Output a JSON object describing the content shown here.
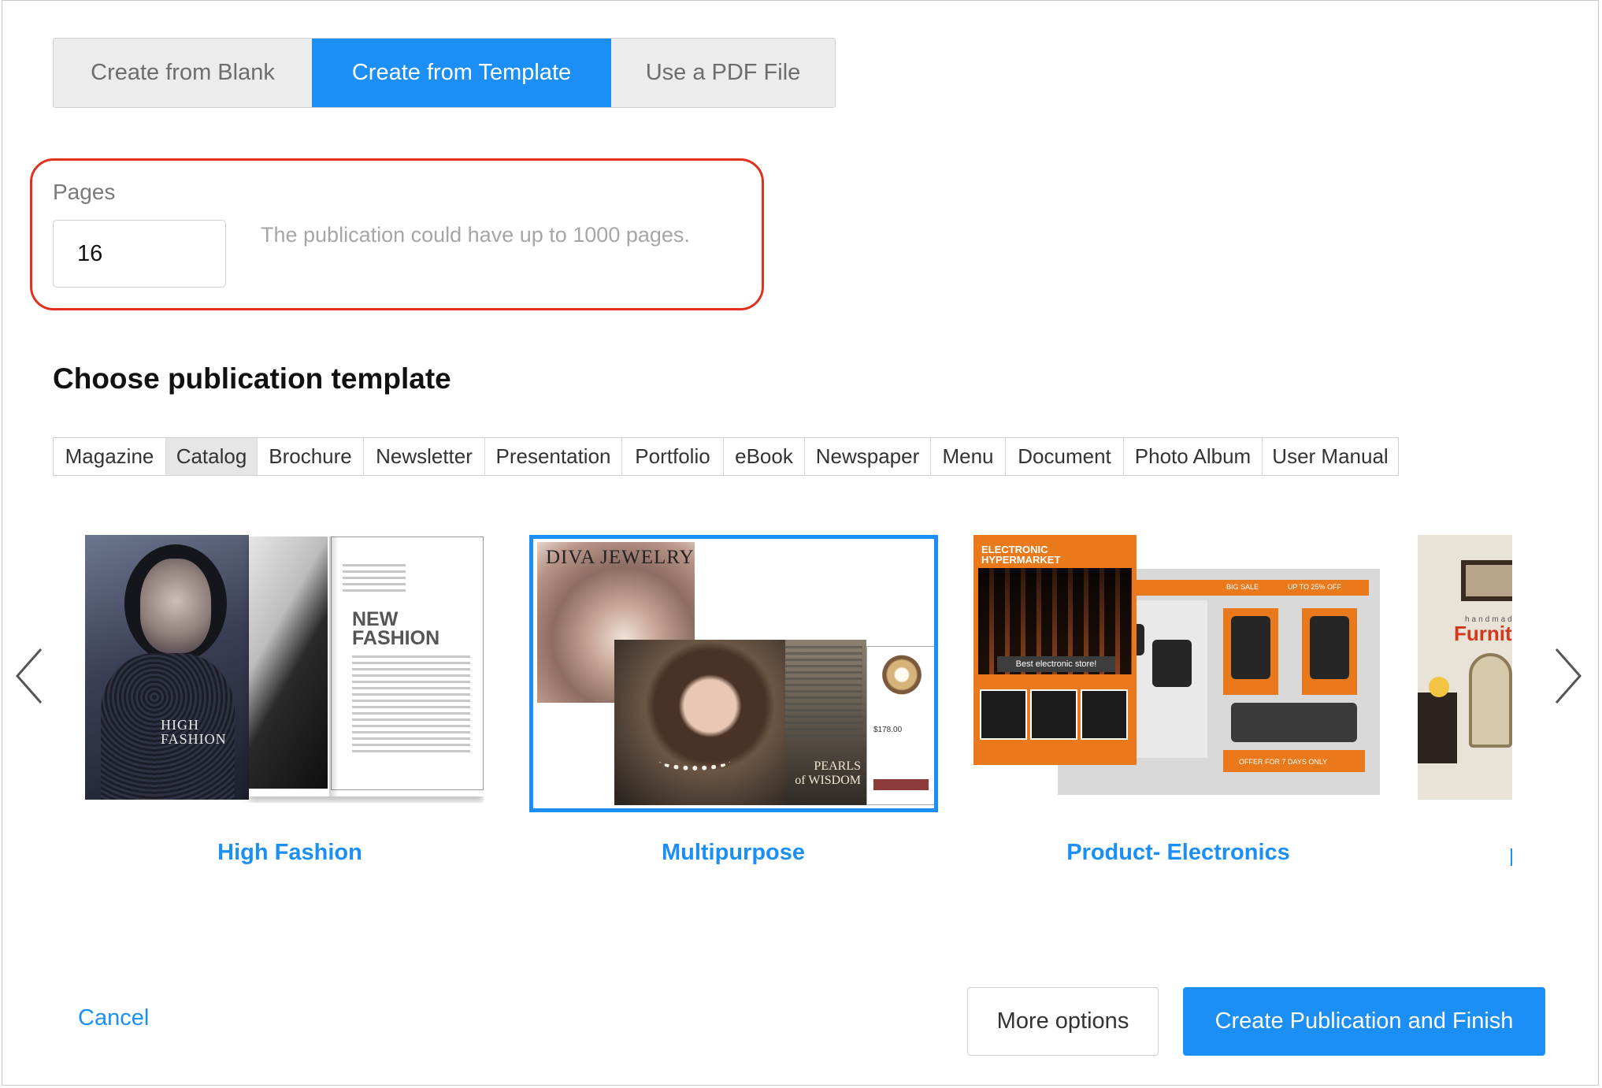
{
  "mode_tabs": [
    {
      "label": "Create from Blank",
      "active": false
    },
    {
      "label": "Create from Template",
      "active": true
    },
    {
      "label": "Use a PDF File",
      "active": false
    }
  ],
  "pages": {
    "label": "Pages",
    "value": "16",
    "hint": "The publication could have up to 1000 pages."
  },
  "section_title": "Choose publication template",
  "categories": [
    {
      "label": "Magazine",
      "active": false
    },
    {
      "label": "Catalog",
      "active": true
    },
    {
      "label": "Brochure",
      "active": false
    },
    {
      "label": "Newsletter",
      "active": false
    },
    {
      "label": "Presentation",
      "active": false
    },
    {
      "label": "Portfolio",
      "active": false
    },
    {
      "label": "eBook",
      "active": false
    },
    {
      "label": "Newspaper",
      "active": false
    },
    {
      "label": "Menu",
      "active": false
    },
    {
      "label": "Document",
      "active": false
    },
    {
      "label": "Photo Album",
      "active": false
    },
    {
      "label": "User Manual",
      "active": false
    }
  ],
  "templates": [
    {
      "name": "High Fashion",
      "selected": false,
      "thumb_text": {
        "cover": "HIGH\nFASHION",
        "headline": "NEW\nFASHION"
      }
    },
    {
      "name": "Multipurpose",
      "selected": true,
      "thumb_text": {
        "cover": "DIVA JEWELRY",
        "quote": "PEARLS\nof WISDOM",
        "price": "$178.00"
      }
    },
    {
      "name": "Product- Electronics",
      "selected": false,
      "thumb_text": {
        "cover": "ELECTRONIC\nHYPERMARKET",
        "banner": "Best electronic store!",
        "sale": "BIG SALE",
        "offer": "UP TO 25% OFF",
        "footer": "OFFER FOR 7 DAYS ONLY"
      }
    },
    {
      "name": "",
      "selected": false,
      "thumb_text": {
        "small": "handmade",
        "headline": "Furniture"
      }
    }
  ],
  "colors": {
    "accent": "#1b8ff5",
    "highlight": "#e0301e",
    "electronics_orange": "#e9791a"
  },
  "icons": {
    "prev": "chevron-left-icon",
    "next": "chevron-right-icon"
  },
  "footer": {
    "cancel_label": "Cancel",
    "more_options_label": "More options",
    "create_label": "Create Publication and Finish"
  }
}
